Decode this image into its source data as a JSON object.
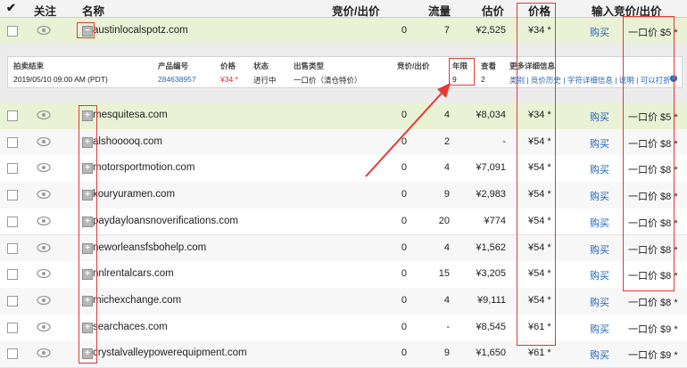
{
  "header": {
    "follow": "关注",
    "name": "名称",
    "bid_ask": "竞价/出价",
    "traffic": "流量",
    "valuation": "估价",
    "price": "价格",
    "input_bid": "输入竞价/出价"
  },
  "expanded": {
    "domain": "austinlocalspotz.com",
    "bids": "0",
    "traffic": "7",
    "valuation": "¥2,525",
    "price": "¥34 *",
    "buy": "购买",
    "bin": "一口价 $5 *"
  },
  "detail": {
    "headers": {
      "end": "拍卖结束",
      "id": "产品编号",
      "price": "价格",
      "status": "状态",
      "sale_type": "出售类型",
      "bid_ask": "竞价/出价",
      "age": "年限",
      "views": "查看",
      "more": "更多详细信息"
    },
    "values": {
      "end": "2019/05/10 09:00 AM (PDT)",
      "id": "284638957",
      "price": "¥34 *",
      "status": "进行中",
      "sale_type": "一口价（清仓特价）",
      "age": "9",
      "views": "2",
      "more": "类别 | 竞价历史 | 字符详细信息 | 说明 | 可以打折"
    }
  },
  "rows": [
    {
      "domain": "mesquitesa.com",
      "bids": "0",
      "traffic": "4",
      "valuation": "¥8,034",
      "price": "¥34 *",
      "buy": "购买",
      "bin": "一口价 $5 *"
    },
    {
      "domain": "alshooooq.com",
      "bids": "0",
      "traffic": "2",
      "valuation": "-",
      "price": "¥54 *",
      "buy": "购买",
      "bin": "一口价 $8 *"
    },
    {
      "domain": "motorsportmotion.com",
      "bids": "0",
      "traffic": "4",
      "valuation": "¥7,091",
      "price": "¥54 *",
      "buy": "购买",
      "bin": "一口价 $8 *"
    },
    {
      "domain": "kouryuramen.com",
      "bids": "0",
      "traffic": "9",
      "valuation": "¥2,983",
      "price": "¥54 *",
      "buy": "购买",
      "bin": "一口价 $8 *"
    },
    {
      "domain": "paydayloansnoverifications.com",
      "bids": "0",
      "traffic": "20",
      "valuation": "¥774",
      "price": "¥54 *",
      "buy": "购买",
      "bin": "一口价 $8 *"
    },
    {
      "domain": "neworleansfsbohelp.com",
      "bids": "0",
      "traffic": "4",
      "valuation": "¥1,562",
      "price": "¥54 *",
      "buy": "购买",
      "bin": "一口价 $8 *"
    },
    {
      "domain": "nnlrentalcars.com",
      "bids": "0",
      "traffic": "15",
      "valuation": "¥3,205",
      "price": "¥54 *",
      "buy": "购买",
      "bin": "一口价 $8 *"
    },
    {
      "domain": "michexchange.com",
      "bids": "0",
      "traffic": "4",
      "valuation": "¥9,111",
      "price": "¥54 *",
      "buy": "购买",
      "bin": "一口价 $8 *"
    },
    {
      "domain": "searchaces.com",
      "bids": "0",
      "traffic": "-",
      "valuation": "¥8,545",
      "price": "¥61 *",
      "buy": "购买",
      "bin": "一口价 $9 *"
    },
    {
      "domain": "crystalvalleypowerequipment.com",
      "bids": "0",
      "traffic": "9",
      "valuation": "¥1,650",
      "price": "¥61 *",
      "buy": "购买",
      "bin": "一口价 $9 *"
    }
  ],
  "colors": {
    "highlight_row": "#eaf2d6",
    "annotation": "#e53935",
    "link": "#2266bb"
  }
}
